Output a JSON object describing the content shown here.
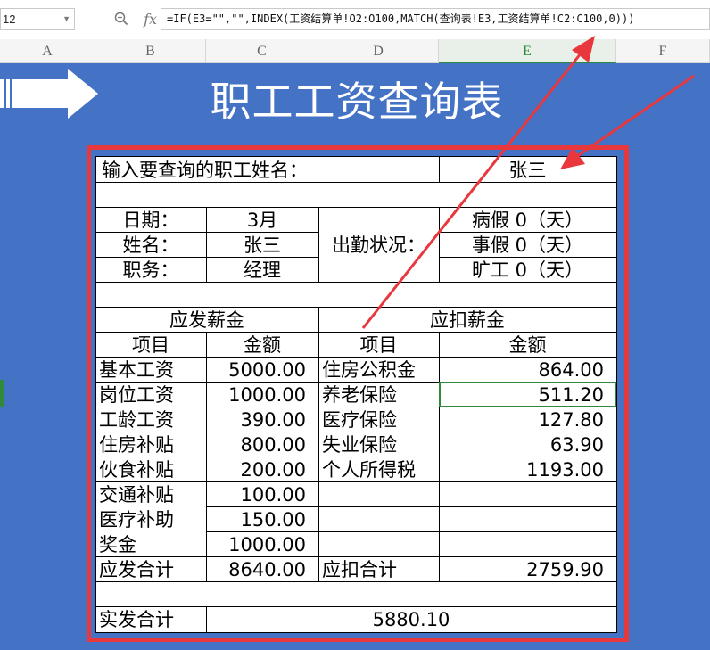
{
  "formula_bar": {
    "name_box": "12",
    "zoom_icon": "magnifier-icon",
    "fx_label": "fx",
    "formula": "=IF(E3=\"\",\"\",INDEX(工资结算单!O2:O100,MATCH(查询表!E3,工资结算单!C2:C100,0)))"
  },
  "columns": [
    "A",
    "B",
    "C",
    "D",
    "E",
    "F"
  ],
  "selected_column": "E",
  "title": "职工工资查询表",
  "query": {
    "label": "输入要查询的职工姓名：",
    "value": "张三"
  },
  "info": {
    "date_label": "日期：",
    "date_value": "3月",
    "name_label": "姓名：",
    "name_value": "张三",
    "position_label": "职务：",
    "position_value": "经理",
    "attendance_label": "出勤状况：",
    "sick_leave": "病假 0（天）",
    "personal_leave": "事假 0（天）",
    "absent": "旷工 0（天）"
  },
  "earnings": {
    "header": "应发薪金",
    "col_item": "项目",
    "col_amount": "金额",
    "rows": [
      {
        "item": "基本工资",
        "amount": "5000.00"
      },
      {
        "item": "岗位工资",
        "amount": "1000.00"
      },
      {
        "item": "工龄工资",
        "amount": "390.00"
      },
      {
        "item": "住房补贴",
        "amount": "800.00"
      },
      {
        "item": "伙食补贴",
        "amount": "200.00"
      },
      {
        "item": "交通补贴",
        "amount": "100.00"
      },
      {
        "item": "医疗补助",
        "amount": "150.00"
      },
      {
        "item": "奖金",
        "amount": "1000.00"
      }
    ],
    "total_label": "应发合计",
    "total_value": "8640.00"
  },
  "deductions": {
    "header": "应扣薪金",
    "col_item": "项目",
    "col_amount": "金额",
    "rows": [
      {
        "item": "住房公积金",
        "amount": "864.00"
      },
      {
        "item": "养老保险",
        "amount": "511.20"
      },
      {
        "item": "医疗保险",
        "amount": "127.80"
      },
      {
        "item": "失业保险",
        "amount": "63.90"
      },
      {
        "item": "个人所得税",
        "amount": "1193.00"
      }
    ],
    "total_label": "应扣合计",
    "total_value": "2759.90"
  },
  "net": {
    "label": "实发合计",
    "value": "5880.10"
  },
  "colors": {
    "sheet_bg": "#4472c4",
    "frame": "#e8373d",
    "selection": "#2f8a3c",
    "annotation_arrow": "#e8373d"
  }
}
